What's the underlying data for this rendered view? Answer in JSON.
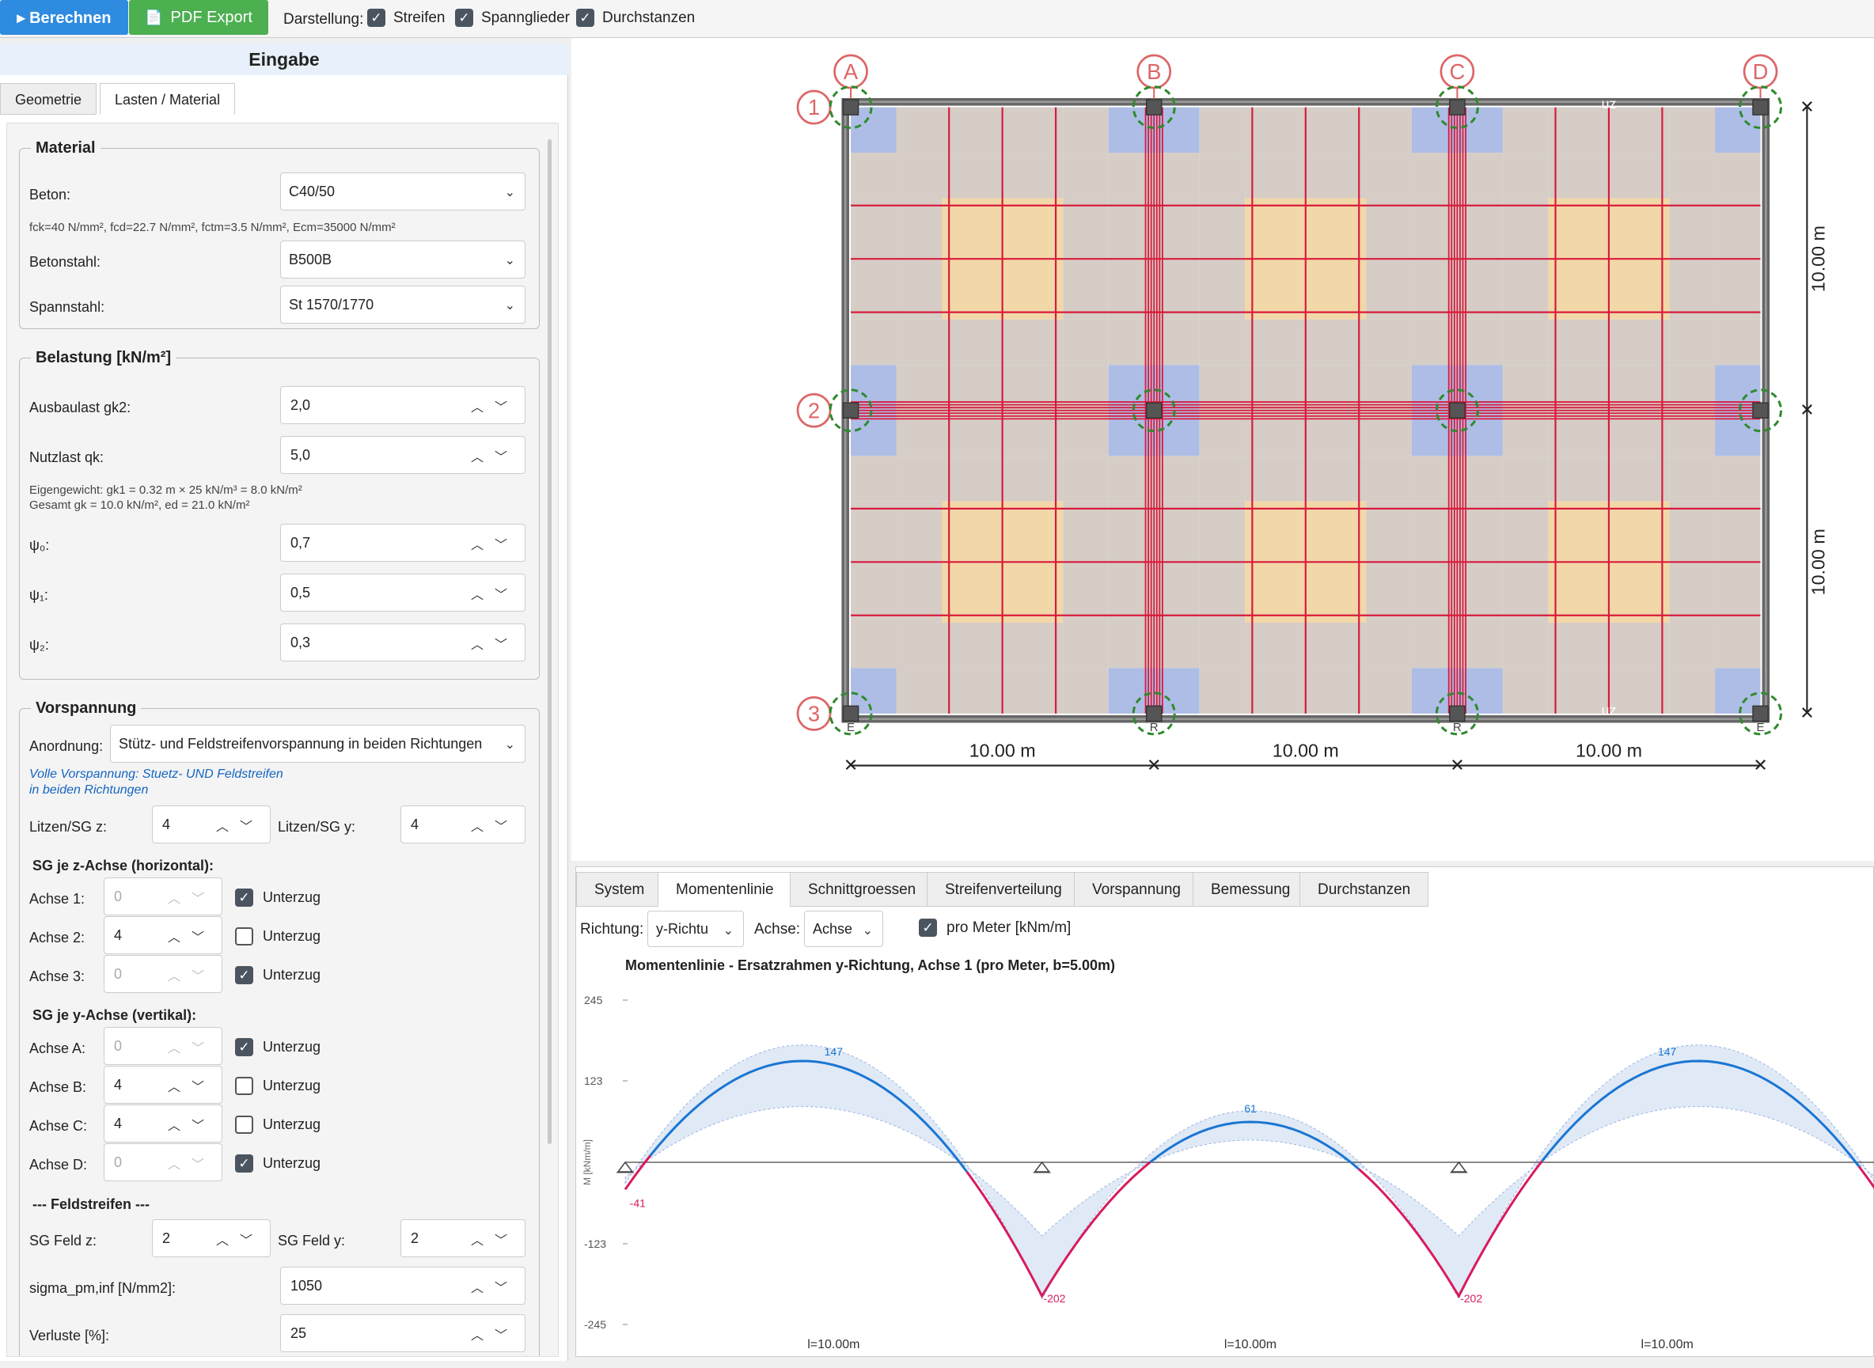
{
  "toolbar": {
    "calc_label": "▸ Berechnen",
    "pdf_label": "PDF Export",
    "darstellung_label": "Darstellung:",
    "checkboxes": [
      {
        "label": "Streifen",
        "checked": true
      },
      {
        "label": "Spannglieder",
        "checked": true
      },
      {
        "label": "Durchstanzen",
        "checked": true
      }
    ]
  },
  "left": {
    "title": "Eingabe",
    "tabs": [
      "Geometrie",
      "Lasten / Material"
    ],
    "material": {
      "legend": "Material",
      "beton_label": "Beton:",
      "beton_value": "C40/50",
      "beton_info": "fck=40 N/mm², fcd=22.7 N/mm², fctm=3.5 N/mm², Ecm=35000 N/mm²",
      "betonstahl_label": "Betonstahl:",
      "betonstahl_value": "B500B",
      "spannstahl_label": "Spannstahl:",
      "spannstahl_value": "St 1570/1770"
    },
    "belastung": {
      "legend": "Belastung [kN/m²]",
      "ausbau_label": "Ausbaulast gk2:",
      "ausbau_value": "2,0",
      "nutz_label": "Nutzlast qk:",
      "nutz_value": "5,0",
      "info1": "Eigengewicht: gk1 = 0.32 m × 25 kN/m³ = 8.0 kN/m²",
      "info2": "Gesamt gk = 10.0 kN/m², ed = 21.0 kN/m²",
      "psi0_label": "ψ₀:",
      "psi0_value": "0,7",
      "psi1_label": "ψ₁:",
      "psi1_value": "0,5",
      "psi2_label": "ψ₂:",
      "psi2_value": "0,3"
    },
    "vorspannung": {
      "legend": "Vorspannung",
      "anordnung_label": "Anordnung:",
      "anordnung_value": "Stütz- und Feldstreifenvorspannung in beiden Richtungen",
      "info1": "Volle Vorspannung: Stuetz- UND Feldstreifen",
      "info2": "in beiden Richtungen",
      "litzen_z_label": "Litzen/SG z:",
      "litzen_z_value": "4",
      "litzen_y_label": "Litzen/SG y:",
      "litzen_y_value": "4",
      "sg_z_head": "SG je z-Achse (horizontal):",
      "sg_z": [
        {
          "label": "Achse 1:",
          "value": "0",
          "disabled": true,
          "unterzug": true
        },
        {
          "label": "Achse 2:",
          "value": "4",
          "disabled": false,
          "unterzug": false
        },
        {
          "label": "Achse 3:",
          "value": "0",
          "disabled": true,
          "unterzug": true
        }
      ],
      "sg_y_head": "SG je y-Achse (vertikal):",
      "sg_y": [
        {
          "label": "Achse A:",
          "value": "0",
          "disabled": true,
          "unterzug": true
        },
        {
          "label": "Achse B:",
          "value": "4",
          "disabled": false,
          "unterzug": false
        },
        {
          "label": "Achse C:",
          "value": "4",
          "disabled": false,
          "unterzug": false
        },
        {
          "label": "Achse D:",
          "value": "0",
          "disabled": true,
          "unterzug": true
        }
      ],
      "unterzug_label": "Unterzug",
      "feld_head": "--- Feldstreifen ---",
      "feld_z_label": "SG Feld z:",
      "feld_z_value": "2",
      "feld_y_label": "SG Feld y:",
      "feld_y_value": "2",
      "sigma_label": "sigma_pm,inf [N/mm2]:",
      "sigma_value": "1050",
      "verluste_label": "Verluste [%]:",
      "verluste_value": "25"
    }
  },
  "drawing": {
    "col_labels": [
      "A",
      "B",
      "C",
      "D"
    ],
    "row_labels": [
      "1",
      "2",
      "3"
    ],
    "span_x": [
      "10.00 m",
      "10.00 m",
      "10.00 m"
    ],
    "span_y": [
      "10.00 m",
      "10.00 m"
    ],
    "uz": "uz",
    "bottom_marks": [
      "E",
      "R",
      "R",
      "E"
    ],
    "colors": {
      "support_strip": "#aebde6",
      "middle": "#d5cdc6",
      "field": "#f2d7a8",
      "tendon": "#d81b3c",
      "axis_circle": "#d66",
      "punch": "#2e8b2e"
    }
  },
  "bottom": {
    "tabs": [
      "System",
      "Momentenlinie",
      "Schnittgroessen",
      "Streifenverteilung",
      "Vorspannung",
      "Bemessung",
      "Durchstanzen"
    ],
    "active_tab": 1,
    "richtung_label": "Richtung:",
    "richtung_value": "y-Richtu",
    "achse_label": "Achse:",
    "achse_value": "Achse",
    "pro_meter_label": "pro Meter [kNm/m]",
    "chart_data": {
      "type": "line",
      "title": "Momentenlinie - Ersatzrahmen y-Richtung, Achse 1 (pro Meter, b=5.00m)",
      "ylabel": "M [kNm/m]",
      "yticks": [
        "245",
        "123",
        "0",
        "-123",
        "-245"
      ],
      "ylim": [
        -245,
        245
      ],
      "span_labels": [
        "l=10.00m",
        "l=10.00m",
        "l=10.00m"
      ],
      "data_labels": [
        "147",
        "61",
        "147",
        "-41",
        "-202",
        "-202"
      ],
      "series": [
        {
          "x": [
            0,
            1.5,
            5,
            8.5,
            10,
            11.5,
            15,
            18.5,
            20,
            21.5,
            25,
            28.5,
            30
          ],
          "y": [
            -41,
            20,
            147,
            20,
            -202,
            20,
            61,
            20,
            -202,
            20,
            147,
            20,
            -41
          ]
        }
      ],
      "colors": {
        "positive": "#1976d2",
        "negative": "#d81b60",
        "envelope": "#c6d7ee"
      }
    }
  }
}
